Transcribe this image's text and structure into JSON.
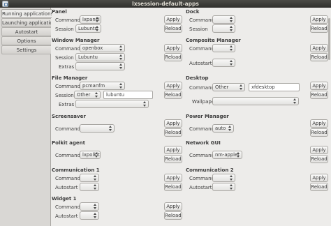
{
  "window": {
    "title": "lxsession-default-apps",
    "icon": "application-icon"
  },
  "tabs": [
    "Running applications",
    "Launching applications",
    "Autostart",
    "Options",
    "Settings"
  ],
  "common": {
    "command_label": "Command",
    "session_label": "Session",
    "extras_label": "Extras",
    "autostart_label": "Autostart",
    "wallpaper_label": "Wallpaper",
    "apply": "Apply",
    "reload": "Reload"
  },
  "panel": {
    "title": "Panel",
    "command": "lxpanel",
    "session": "Lubuntu"
  },
  "dock": {
    "title": "Dock",
    "command": "",
    "session": ""
  },
  "window_manager": {
    "title": "Window Manager",
    "command": "openbox",
    "session": "Lubuntu",
    "extras": ""
  },
  "composite_manager": {
    "title": "Composite Manager",
    "command": "",
    "autostart": ""
  },
  "file_manager": {
    "title": "File Manager",
    "command": "pcmanfm",
    "session": "Other",
    "session_custom": "lubuntu",
    "extras": ""
  },
  "desktop": {
    "title": "Desktop",
    "command": "Other",
    "command_custom": "xfdesktop",
    "wallpaper": ""
  },
  "screensaver": {
    "title": "Screensaver",
    "command": ""
  },
  "power_manager": {
    "title": "Power Manager",
    "command": "auto"
  },
  "polkit_agent": {
    "title": "Polkit agent",
    "command": "lxpolkit"
  },
  "network_gui": {
    "title": "Network GUI",
    "command": "nm-applet"
  },
  "communication_1": {
    "title": "Communication 1",
    "command": "",
    "autostart": ""
  },
  "communication_2": {
    "title": "Communication 2",
    "command": "",
    "autostart": ""
  },
  "widget_1": {
    "title": "Widget 1",
    "command": "",
    "autostart": ""
  }
}
